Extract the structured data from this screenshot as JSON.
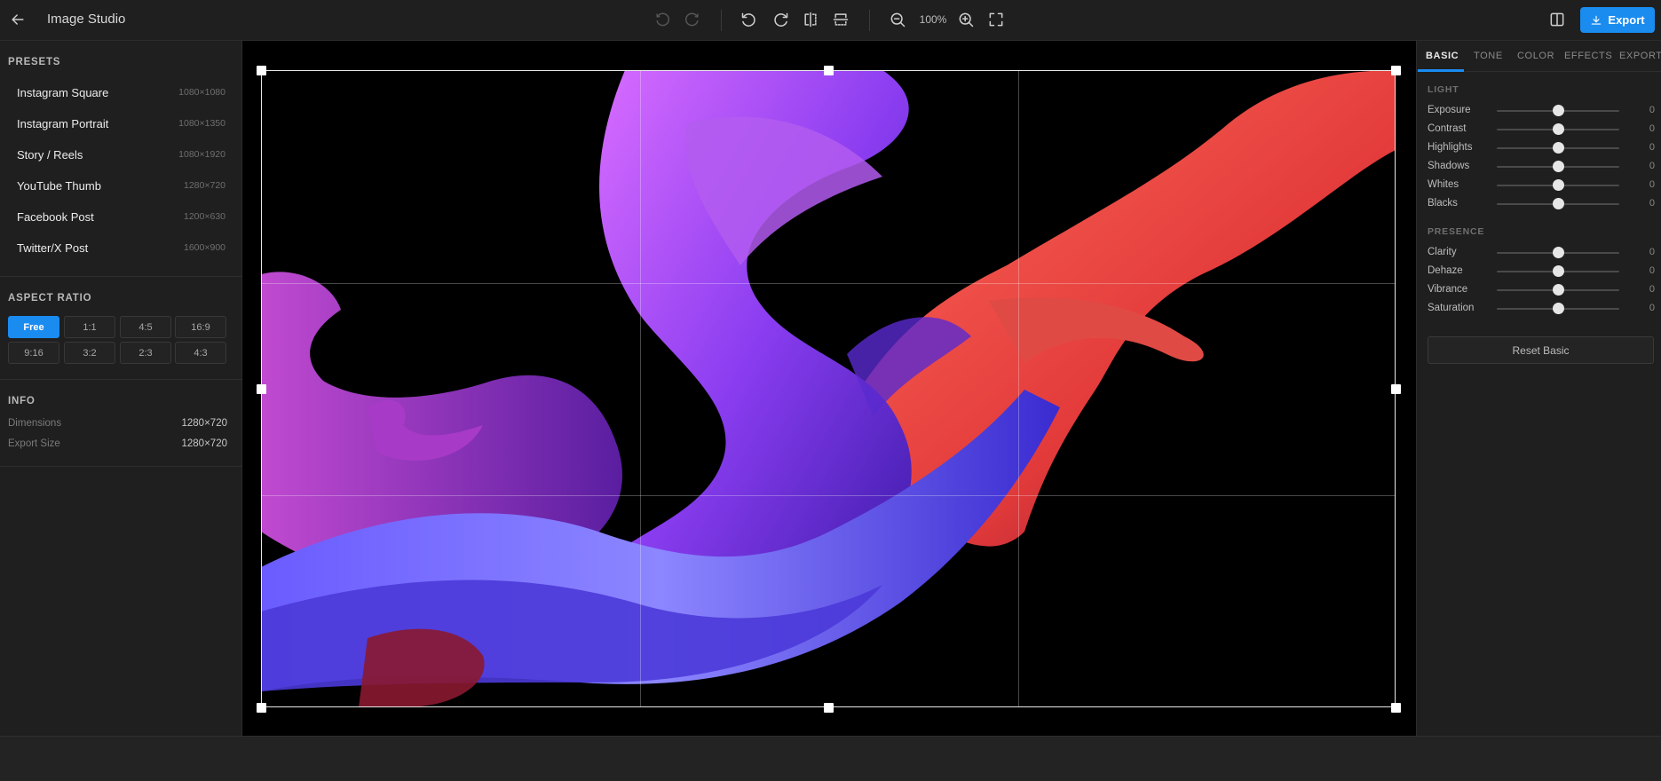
{
  "app": {
    "title": "Image Studio",
    "zoom": "100%",
    "export_label": "Export",
    "accent": "#1a8cf0"
  },
  "toolbar": {
    "back_icon": "arrow-left-icon",
    "undo_icon": "undo-icon",
    "redo_icon": "redo-icon",
    "rotate_left_icon": "rotate-left-icon",
    "rotate_right_icon": "rotate-right-icon",
    "flip_horizontal_icon": "flip-horizontal-icon",
    "flip_vertical_icon": "flip-vertical-icon",
    "zoom_out_icon": "zoom-out-icon",
    "zoom_in_icon": "zoom-in-icon",
    "fit_icon": "fullscreen-icon",
    "compare_icon": "split-view-icon",
    "export_icon": "download-icon"
  },
  "presets": {
    "title": "PRESETS",
    "items": [
      {
        "name": "Instagram Square",
        "size": "1080×1080"
      },
      {
        "name": "Instagram Portrait",
        "size": "1080×1350"
      },
      {
        "name": "Story / Reels",
        "size": "1080×1920"
      },
      {
        "name": "YouTube Thumb",
        "size": "1280×720"
      },
      {
        "name": "Facebook Post",
        "size": "1200×630"
      },
      {
        "name": "Twitter/X Post",
        "size": "1600×900"
      }
    ]
  },
  "aspect_ratio": {
    "title": "ASPECT RATIO",
    "options": [
      "Free",
      "1:1",
      "4:5",
      "16:9",
      "9:16",
      "3:2",
      "2:3",
      "4:3"
    ],
    "selected": "Free"
  },
  "info": {
    "title": "INFO",
    "rows": [
      {
        "label": "Dimensions",
        "value": "1280×720"
      },
      {
        "label": "Export Size",
        "value": "1280×720"
      }
    ]
  },
  "panel": {
    "tabs": [
      "BASIC",
      "TONE",
      "COLOR",
      "EFFECTS",
      "EXPORT"
    ],
    "active_tab": "BASIC",
    "groups": [
      {
        "title": "LIGHT",
        "sliders": [
          {
            "label": "Exposure",
            "value": "0"
          },
          {
            "label": "Contrast",
            "value": "0"
          },
          {
            "label": "Highlights",
            "value": "0"
          },
          {
            "label": "Shadows",
            "value": "0"
          },
          {
            "label": "Whites",
            "value": "0"
          },
          {
            "label": "Blacks",
            "value": "0"
          }
        ]
      },
      {
        "title": "PRESENCE",
        "sliders": [
          {
            "label": "Clarity",
            "value": "0"
          },
          {
            "label": "Dehaze",
            "value": "0"
          },
          {
            "label": "Vibrance",
            "value": "0"
          },
          {
            "label": "Saturation",
            "value": "0"
          }
        ]
      }
    ],
    "reset_label": "Reset Basic"
  }
}
